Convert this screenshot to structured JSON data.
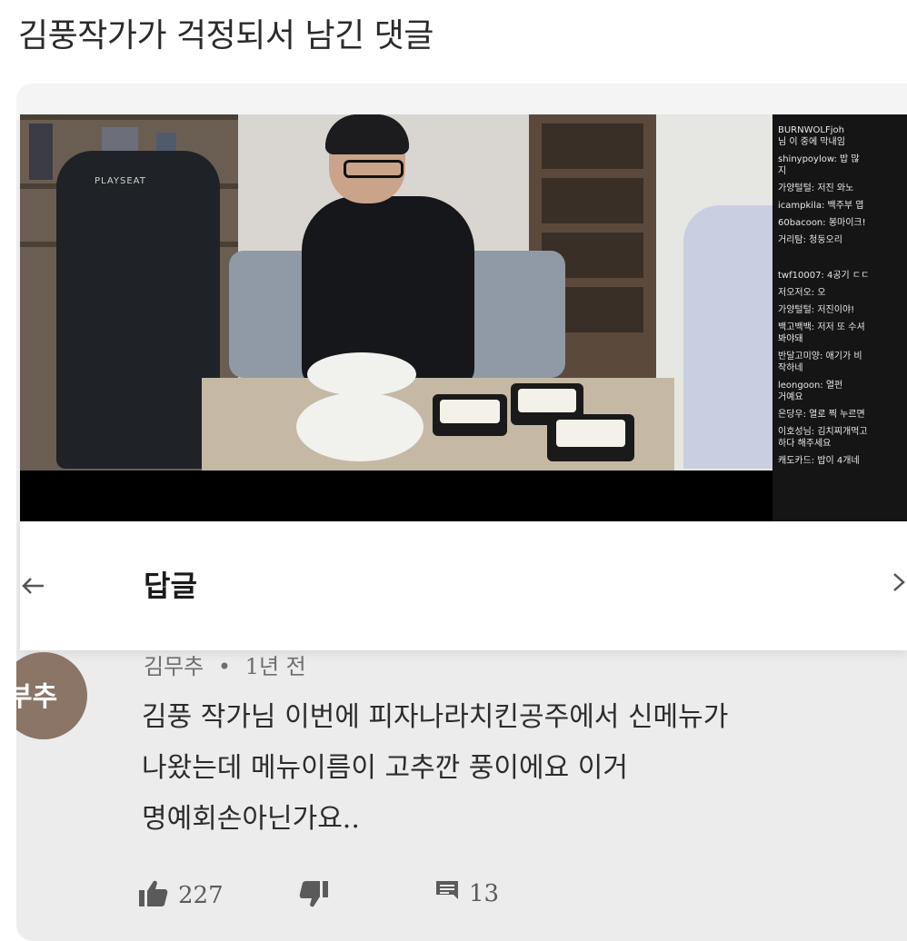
{
  "post": {
    "title": "김풍작가가 걱정되서 남긴 댓글"
  },
  "video": {
    "chair_brand": "PLAYSEAT",
    "chat": [
      "BURNWOLFjoh",
      "님 이 중에 막내임",
      "shinypoylow: 밥 많",
      "지",
      "가양털털: 저진 와노",
      "icampkila: 백주부 엽",
      "60bacoon: 봉마이크!",
      "거리탐: 청둥오리",
      "twf10007: 4공기 ㄷㄷ",
      "저오저오: 오",
      "가양털털: 저진이야!",
      "백고백백: 저저 또 수셔",
      "봐야돼",
      "반달고미양: 애기가 비",
      "작하네",
      "leongoon: 열펀",
      "거예요",
      "은당우: 열로 찍 누르면",
      "이호성님: 김치찌개먹고",
      "하다 해주세요",
      "캐도카드: 밥이 4개네"
    ]
  },
  "reply_header": {
    "title": "답글",
    "back_icon": "arrow-left-icon",
    "forward_icon": "chevron-right-icon"
  },
  "comment": {
    "avatar_text": "부추",
    "author": "김무추",
    "separator": "•",
    "time": "1년 전",
    "lines": [
      "김풍 작가님 이번에 피자나라치킨공주에서 신메뉴가",
      "나왔는데 메뉴이름이 고추깐 풍이에요 이거",
      "명예회손아닌가요.."
    ],
    "likes": "227",
    "replies": "13",
    "icons": {
      "like": "thumbs-up-icon",
      "dislike": "thumbs-down-icon",
      "reply": "comment-icon"
    }
  }
}
